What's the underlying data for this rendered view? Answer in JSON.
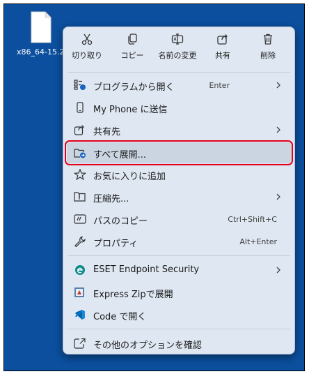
{
  "desktop": {
    "file_name": "x86_64-15.2."
  },
  "toolbar": [
    {
      "label": "切り取り",
      "icon": "scissors-icon"
    },
    {
      "label": "コピー",
      "icon": "copy-icon"
    },
    {
      "label": "名前の変更",
      "icon": "rename-icon"
    },
    {
      "label": "共有",
      "icon": "share-icon"
    },
    {
      "label": "削除",
      "icon": "trash-icon"
    }
  ],
  "items": [
    {
      "label": "プログラムから開く",
      "shortcut": "Enter",
      "icon": "open-with-icon",
      "submenu": true
    },
    {
      "label": "My Phone に送信",
      "shortcut": "",
      "icon": "phone-icon",
      "submenu": false
    },
    {
      "label": "共有先",
      "shortcut": "",
      "icon": "share-icon",
      "submenu": true
    },
    {
      "label": "すべて展開...",
      "shortcut": "",
      "icon": "extract-folder-icon",
      "submenu": false
    },
    {
      "label": "お気に入りに追加",
      "shortcut": "",
      "icon": "star-icon",
      "submenu": false
    },
    {
      "label": "圧縮先...",
      "shortcut": "",
      "icon": "zip-folder-icon",
      "submenu": true
    },
    {
      "label": "パスのコピー",
      "shortcut": "Ctrl+Shift+C",
      "icon": "copy-path-icon",
      "submenu": false
    },
    {
      "label": "プロパティ",
      "shortcut": "Alt+Enter",
      "icon": "wrench-icon",
      "submenu": false
    },
    {
      "label": "ESET Endpoint Security",
      "shortcut": "",
      "icon": "eset-icon",
      "submenu": true
    },
    {
      "label": "Express Zipで展開",
      "shortcut": "",
      "icon": "express-zip-icon",
      "submenu": false
    },
    {
      "label": "Code で開く",
      "shortcut": "",
      "icon": "vscode-icon",
      "submenu": false
    },
    {
      "label": "その他のオプションを確認",
      "shortcut": "",
      "icon": "more-options-icon",
      "submenu": false
    }
  ],
  "colors": {
    "desktop": "#0b4f9e",
    "highlight_border": "#e3001b",
    "menu_bg": "#dfe7f2"
  }
}
